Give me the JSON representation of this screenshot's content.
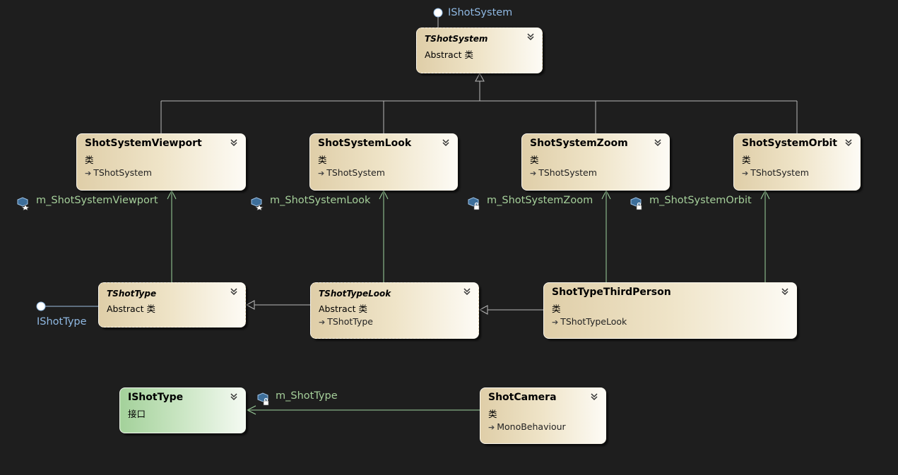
{
  "diagram": {
    "classes": {
      "tshotsystem": {
        "name": "TShotSystem",
        "kind": "Abstract 类"
      },
      "viewport": {
        "name": "ShotSystemViewport",
        "kind": "类",
        "base": "TShotSystem"
      },
      "look": {
        "name": "ShotSystemLook",
        "kind": "类",
        "base": "TShotSystem"
      },
      "zoom": {
        "name": "ShotSystemZoom",
        "kind": "类",
        "base": "TShotSystem"
      },
      "orbit": {
        "name": "ShotSystemOrbit",
        "kind": "类",
        "base": "TShotSystem"
      },
      "tshottype": {
        "name": "TShotType",
        "kind": "Abstract 类"
      },
      "tshottypelook": {
        "name": "TShotTypeLook",
        "kind": "Abstract 类",
        "base": "TShotType"
      },
      "thirdperson": {
        "name": "ShotTypeThirdPerson",
        "kind": "类",
        "base": "TShotTypeLook"
      },
      "ishottype": {
        "name": "IShotType",
        "kind": "接口"
      },
      "shotcamera": {
        "name": "ShotCamera",
        "kind": "类",
        "base": "MonoBehaviour"
      }
    },
    "interface_labels": {
      "ishotsystem": "IShotSystem",
      "ishottype": "IShotType"
    },
    "member_labels": {
      "viewport": "m_ShotSystemViewport",
      "look": "m_ShotSystemLook",
      "zoom": "m_ShotSystemZoom",
      "orbit": "m_ShotSystemOrbit",
      "shottype": "m_ShotType"
    },
    "colors": {
      "background": "#1e1e1e",
      "connector": "#b8b8b8",
      "association": "#9fd49f",
      "interface_text": "#8fb8e2",
      "member_text": "#a5cf9a"
    }
  }
}
